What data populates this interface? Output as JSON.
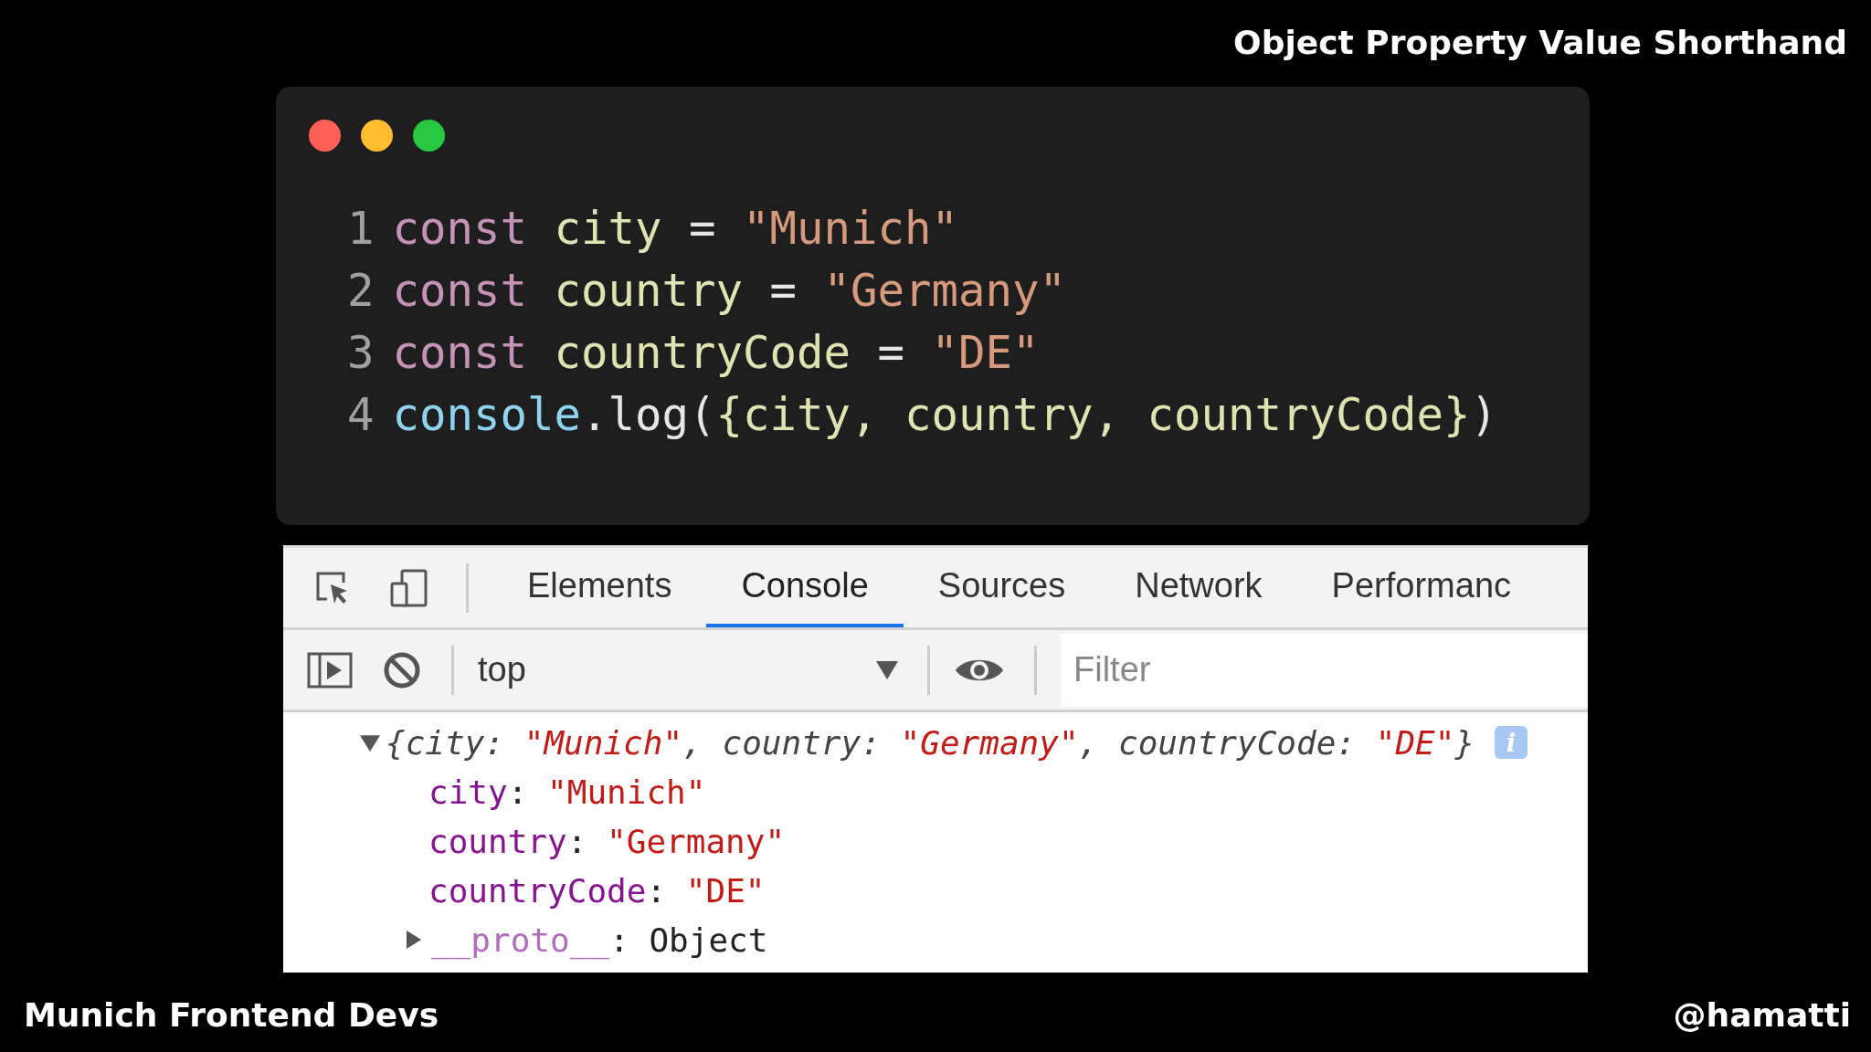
{
  "slide": {
    "title": "Object Property Value Shorthand",
    "footer_left": "Munich Frontend Devs",
    "footer_right": "@hamatti"
  },
  "editor": {
    "lines": [
      {
        "number": "1",
        "tokens": [
          {
            "kind": "keyword",
            "text": "const"
          },
          {
            "kind": "variable",
            "text": " city"
          },
          {
            "kind": "operator",
            "text": " ="
          },
          {
            "kind": "string",
            "text": " \"Munich\""
          }
        ]
      },
      {
        "number": "2",
        "tokens": [
          {
            "kind": "keyword",
            "text": "const"
          },
          {
            "kind": "variable",
            "text": " country"
          },
          {
            "kind": "operator",
            "text": " ="
          },
          {
            "kind": "string",
            "text": " \"Germany\""
          }
        ]
      },
      {
        "number": "3",
        "tokens": [
          {
            "kind": "keyword",
            "text": "const"
          },
          {
            "kind": "variable",
            "text": " countryCode"
          },
          {
            "kind": "operator",
            "text": " ="
          },
          {
            "kind": "string",
            "text": " \"DE\""
          }
        ]
      },
      {
        "number": "4",
        "tokens": [
          {
            "kind": "function",
            "text": "console"
          },
          {
            "kind": "operator",
            "text": ".log("
          },
          {
            "kind": "variable",
            "text": "{city, country, countryCode}"
          },
          {
            "kind": "operator",
            "text": ")"
          }
        ]
      }
    ]
  },
  "devtools": {
    "tabs": [
      {
        "label": "Elements",
        "selected": false
      },
      {
        "label": "Console",
        "selected": true
      },
      {
        "label": "Sources",
        "selected": false
      },
      {
        "label": "Network",
        "selected": false
      },
      {
        "label": "Performanc",
        "selected": false
      }
    ],
    "context": "top",
    "filter": {
      "placeholder": "Filter"
    },
    "console": {
      "expanded": true,
      "info_badge": "i",
      "separator": ":",
      "summary": [
        {
          "kind": "text",
          "text": "{city: "
        },
        {
          "kind": "string",
          "text": "\"Munich\""
        },
        {
          "kind": "text",
          "text": ", country: "
        },
        {
          "kind": "string",
          "text": "\"Germany\""
        },
        {
          "kind": "text",
          "text": ", countryCode: "
        },
        {
          "kind": "string",
          "text": "\"DE\""
        },
        {
          "kind": "text",
          "text": "}"
        }
      ],
      "properties": [
        {
          "key": "city",
          "value": "\"Munich\""
        },
        {
          "key": "country",
          "value": "\"Germany\""
        },
        {
          "key": "countryCode",
          "value": "\"DE\""
        }
      ],
      "proto": {
        "key": "__proto__",
        "value": "Object",
        "expanded": false
      }
    }
  }
}
